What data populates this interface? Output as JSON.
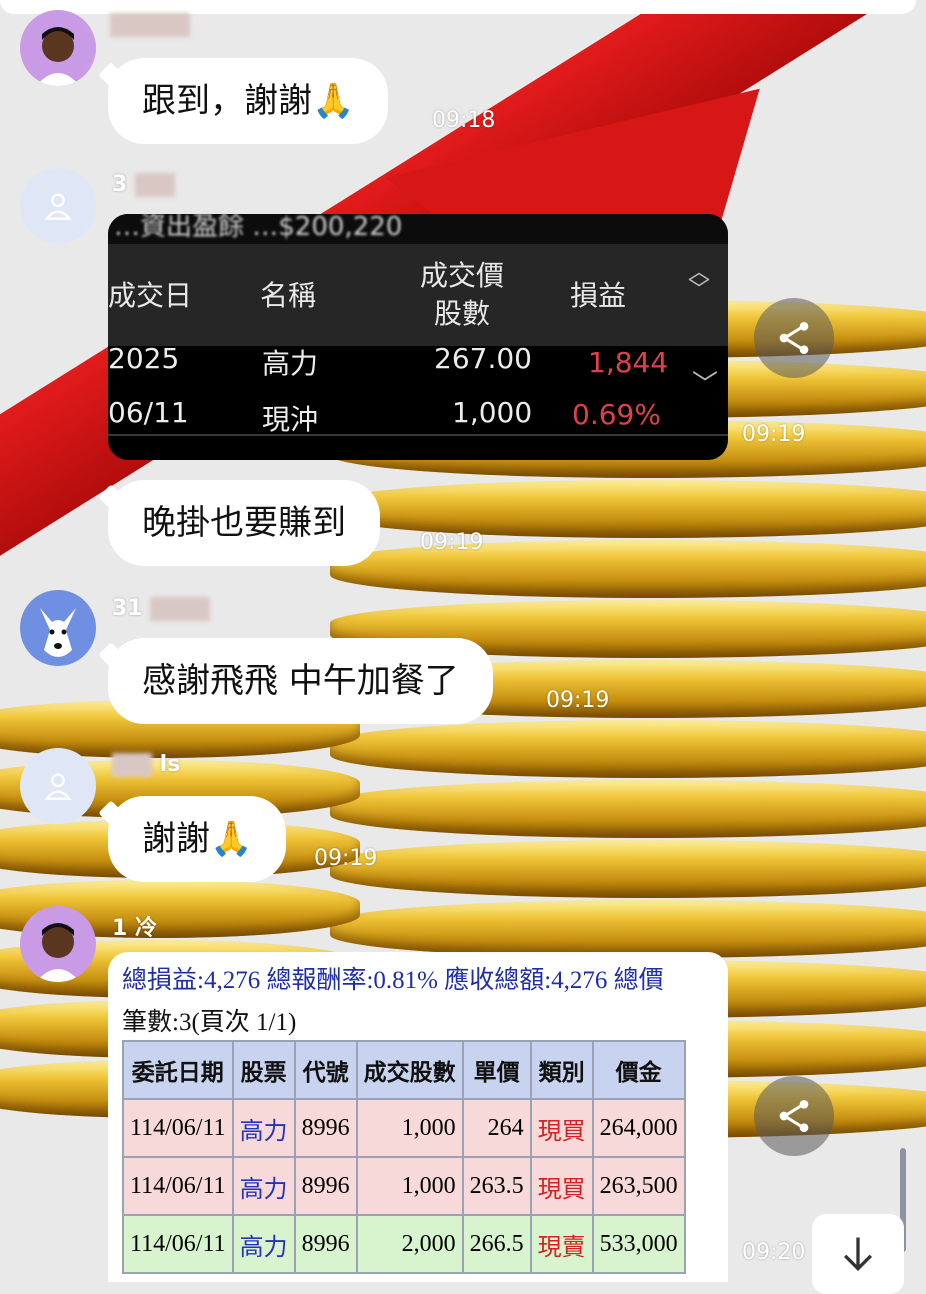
{
  "messages": [
    {
      "sender": "",
      "text": "跟到，謝謝🙏",
      "time": "09:18"
    },
    {
      "sender": "3",
      "image": "trade-screenshot-dark",
      "time": "09:19"
    },
    {
      "sender": "",
      "text": "晚掛也要賺到",
      "time": "09:19"
    },
    {
      "sender": "31",
      "text": "感謝飛飛 中午加餐了",
      "time": "09:19"
    },
    {
      "sender": "ls",
      "text": "謝謝🙏",
      "time": "09:19"
    },
    {
      "sender": "1 冷",
      "image": "trade-screenshot-table",
      "time": "09:20"
    }
  ],
  "img1": {
    "top_faded": "…資出盈餘 …$200,220",
    "headers": {
      "date": "成交日",
      "name": "名稱",
      "price_top": "成交價",
      "price_bottom": "股數",
      "pnl": "損益"
    },
    "row": {
      "date1": "2025",
      "date2": "06/11",
      "name1": "高力",
      "name2": "現沖",
      "price": "267.00",
      "shares": "1,000",
      "pnl": "1,844",
      "pct": "0.69%"
    }
  },
  "img2": {
    "summary": "總損益:4,276 總報酬率:0.81% 應收總額:4,276 總價",
    "count": "筆數:3(頁次 1/1)",
    "headers": [
      "委託日期",
      "股票",
      "代號",
      "成交股數",
      "單價",
      "類別",
      "價金"
    ],
    "rows": [
      [
        "114/06/11",
        "高力",
        "8996",
        "1,000",
        "264",
        "現買",
        "264,000"
      ],
      [
        "114/06/11",
        "高力",
        "8996",
        "1,000",
        "263.5",
        "現買",
        "263,500"
      ],
      [
        "114/06/11",
        "高力",
        "8996",
        "2,000",
        "266.5",
        "現賣",
        "533,000"
      ]
    ]
  },
  "icons": {
    "share": "share-icon",
    "down": "arrow-down-icon",
    "user": "user-icon"
  }
}
